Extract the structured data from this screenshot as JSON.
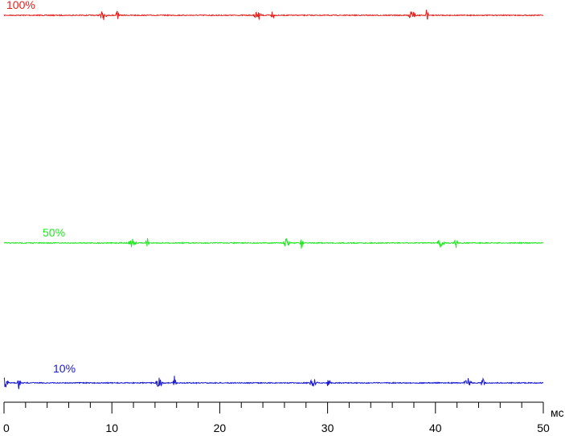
{
  "chart_data": {
    "type": "line",
    "xlabel": "мс",
    "xlim": [
      0,
      50
    ],
    "x_ticks": [
      "0",
      "10",
      "20",
      "30",
      "40",
      "50"
    ],
    "grid": false,
    "legend": "none",
    "series": [
      {
        "name": "100%",
        "color": "#e8201c",
        "bursts_ms": [
          9.2,
          10.5,
          23.5,
          24.9,
          37.8,
          39.2
        ]
      },
      {
        "name": "50%",
        "color": "#22e822",
        "bursts_ms": [
          11.9,
          13.3,
          26.2,
          27.6,
          40.5,
          41.9
        ]
      },
      {
        "name": "10%",
        "color": "#1a1ad0",
        "bursts_ms": [
          0.1,
          1.4,
          14.4,
          15.8,
          28.7,
          30.1,
          43.0,
          44.4
        ]
      }
    ]
  }
}
